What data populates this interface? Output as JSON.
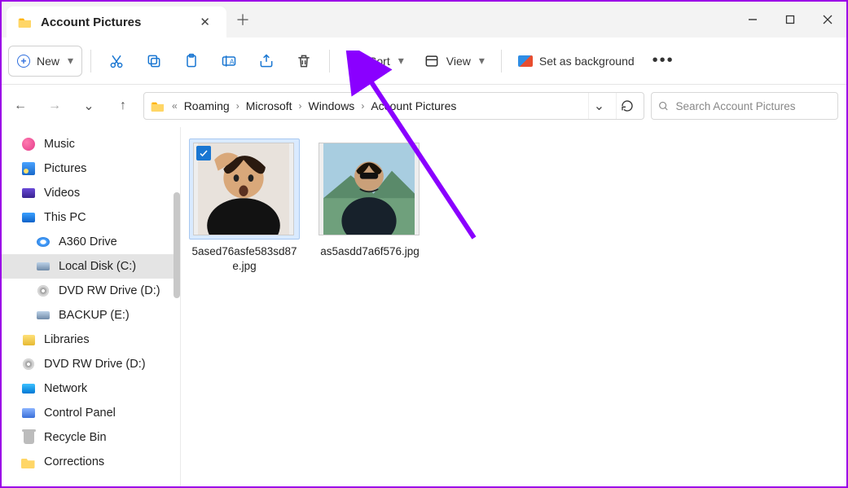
{
  "tab": {
    "title": "Account Pictures"
  },
  "toolbar": {
    "new_label": "New",
    "sort_label": "Sort",
    "view_label": "View",
    "set_bg_label": "Set as background"
  },
  "breadcrumb": {
    "parts": [
      "Roaming",
      "Microsoft",
      "Windows",
      "Account Pictures"
    ]
  },
  "search": {
    "placeholder": "Search Account Pictures"
  },
  "sidebar": {
    "items": [
      {
        "label": "Music",
        "icon": "music",
        "indent": false
      },
      {
        "label": "Pictures",
        "icon": "picture",
        "indent": false
      },
      {
        "label": "Videos",
        "icon": "video",
        "indent": false
      },
      {
        "label": "This PC",
        "icon": "pc",
        "indent": false
      },
      {
        "label": "A360 Drive",
        "icon": "a360",
        "indent": true
      },
      {
        "label": "Local Disk (C:)",
        "icon": "drive",
        "indent": true,
        "selected": true
      },
      {
        "label": "DVD RW Drive (D:)",
        "icon": "dvd",
        "indent": true
      },
      {
        "label": "BACKUP (E:)",
        "icon": "drive",
        "indent": true
      },
      {
        "label": "Libraries",
        "icon": "lib",
        "indent": false
      },
      {
        "label": "DVD RW Drive (D:)",
        "icon": "dvd",
        "indent": false
      },
      {
        "label": "Network",
        "icon": "net",
        "indent": false
      },
      {
        "label": "Control Panel",
        "icon": "cpl",
        "indent": false
      },
      {
        "label": "Recycle Bin",
        "icon": "bin",
        "indent": false
      },
      {
        "label": "Corrections",
        "icon": "folder",
        "indent": false
      }
    ]
  },
  "files": [
    {
      "name": "5ased76asfe583sd87e.jpg",
      "selected": true
    },
    {
      "name": "as5asdd7a6f576.jpg",
      "selected": false
    }
  ]
}
